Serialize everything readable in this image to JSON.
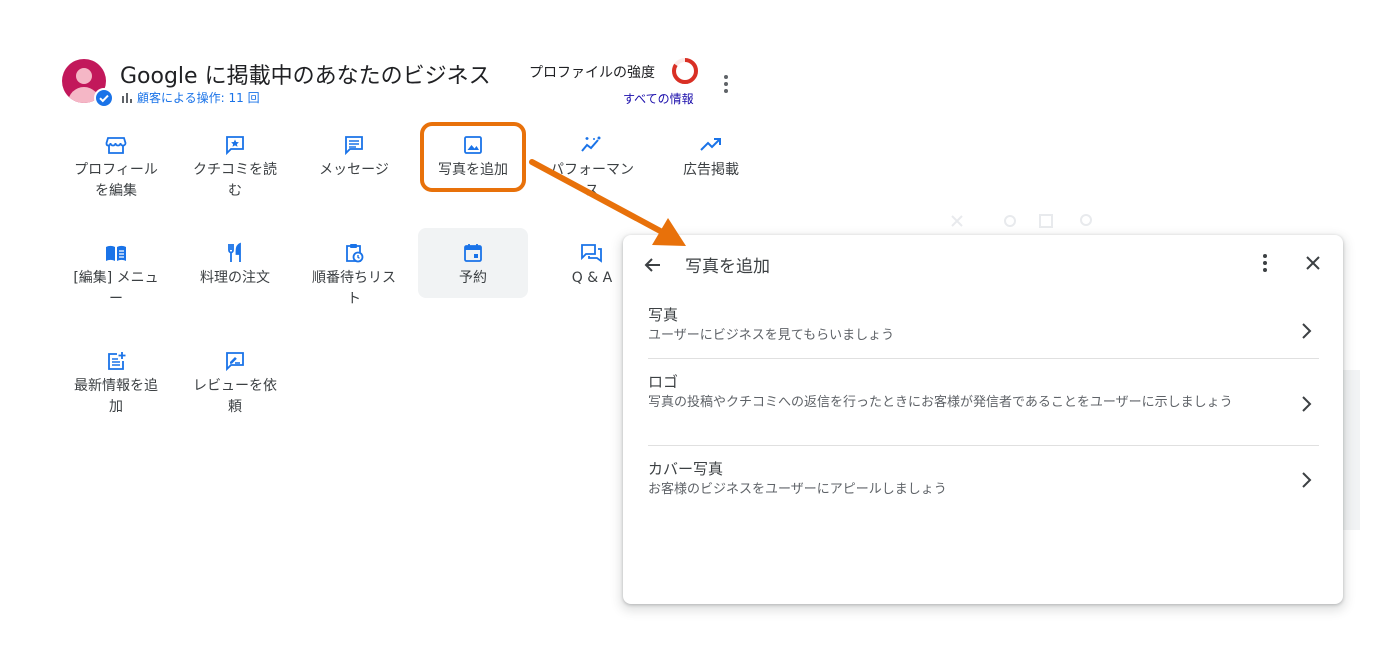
{
  "header": {
    "business_title": "Google に掲載中のあなたのビジネス",
    "interactions": "顧客による操作: 11 回",
    "profile_strength_label": "プロファイルの強度",
    "all_info_link": "すべての情報"
  },
  "actions": [
    {
      "label": "プロフィール\nを編集",
      "icon": "storefront-icon"
    },
    {
      "label": "クチコミを読\nむ",
      "icon": "review-star-icon"
    },
    {
      "label": "メッセージ",
      "icon": "message-icon"
    },
    {
      "label": "写真を追加",
      "icon": "image-icon"
    },
    {
      "label": "パフォーマン\nス",
      "icon": "insights-icon"
    },
    {
      "label": "広告掲載",
      "icon": "trending-up-icon"
    },
    {
      "label": "[編集] メニュ\nー",
      "icon": "menu-book-icon"
    },
    {
      "label": "料理の注文",
      "icon": "restaurant-icon"
    },
    {
      "label": "順番待ちリス\nト",
      "icon": "clipboard-clock-icon"
    },
    {
      "label": "予約",
      "icon": "calendar-icon"
    },
    {
      "label": "Q & A",
      "icon": "forum-icon"
    },
    {
      "label": "最新情報を追\n加",
      "icon": "post-add-icon"
    },
    {
      "label": "レビューを依\n頼",
      "icon": "rate-review-icon"
    }
  ],
  "dialog": {
    "title": "写真を追加",
    "options": [
      {
        "title": "写真",
        "desc": "ユーザーにビジネスを見てもらいましょう"
      },
      {
        "title": "ロゴ",
        "desc": "写真の投稿やクチコミへの返信を行ったときにお客様が発信者であることをユーザーに示しましょう"
      },
      {
        "title": "カバー写真",
        "desc": "お客様のビジネスをユーザーにアピールしましょう"
      }
    ]
  },
  "colors": {
    "accent_blue": "#1a73e8",
    "annotation_orange": "#e8710a",
    "strength_ring": "#d93025",
    "avatar": "#c2185b"
  }
}
